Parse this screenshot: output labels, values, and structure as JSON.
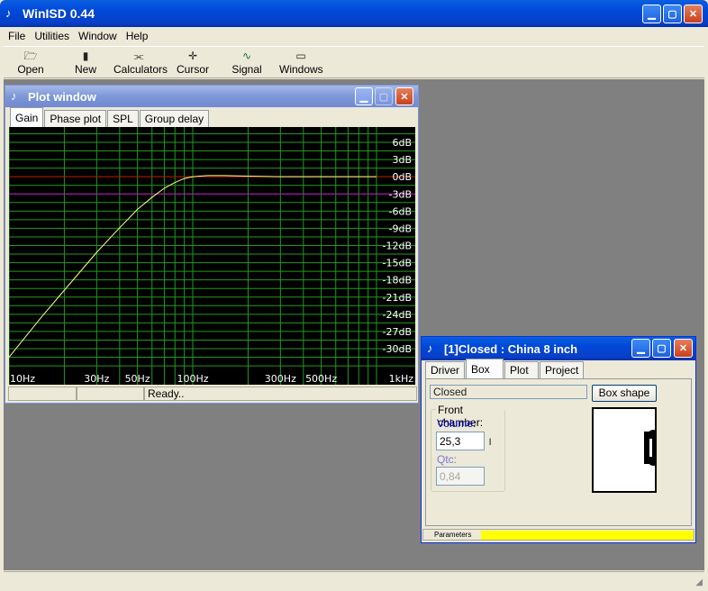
{
  "main_window": {
    "title": "WinISD 0.44",
    "menu": [
      "File",
      "Utilities",
      "Window",
      "Help"
    ],
    "toolbar": [
      {
        "label": "Open",
        "icon": "open-folder-icon"
      },
      {
        "label": "New",
        "icon": "new-document-icon"
      },
      {
        "label": "Calculators",
        "icon": "calculator-icon"
      },
      {
        "label": "Cursor",
        "icon": "cursor-crosshair-icon"
      },
      {
        "label": "Signal gen.",
        "icon": "sine-wave-icon"
      },
      {
        "label": "Windows",
        "icon": "window-icon"
      }
    ]
  },
  "plot_window": {
    "title": "Plot window",
    "tabs": [
      "Gain",
      "Phase plot",
      "SPL",
      "Group delay"
    ],
    "active_tab": "Gain",
    "status_text": "Ready.."
  },
  "chart_data": {
    "type": "line",
    "x_scale": "log",
    "xlim": [
      10,
      1000
    ],
    "ylim": [
      -33,
      9
    ],
    "x_tick_labels": [
      "10Hz",
      "30Hz",
      "50Hz",
      "100Hz",
      "300Hz",
      "500Hz",
      "1kHz"
    ],
    "x_ticks": [
      10,
      30,
      50,
      100,
      300,
      500,
      1000
    ],
    "y_tick_labels": [
      "6dB",
      "3dB",
      "0dB",
      "-3dB",
      "-6dB",
      "-9dB",
      "-12dB",
      "-15dB",
      "-18dB",
      "-21dB",
      "-24dB",
      "-27dB",
      "-30dB"
    ],
    "y_ticks": [
      6,
      3,
      0,
      -3,
      -6,
      -9,
      -12,
      -15,
      -18,
      -21,
      -24,
      -27,
      -30
    ],
    "reference_lines": {
      "red_db": 0,
      "magenta_db": -3
    },
    "series": [
      {
        "color": "#ffff80",
        "x": [
          10,
          15,
          20,
          30,
          40,
          50,
          60,
          70,
          80,
          90,
          100,
          120,
          150,
          200,
          300,
          500,
          1000
        ],
        "y": [
          -31.5,
          -24.5,
          -19.8,
          -13.2,
          -8.9,
          -5.7,
          -3.6,
          -2.0,
          -1.0,
          -0.3,
          0.0,
          0.2,
          0.2,
          0.1,
          0.0,
          0.0,
          0.0
        ]
      }
    ],
    "grid": true
  },
  "driver_window": {
    "title": "[1]Closed : China 8 inch",
    "tabs": [
      "Driver",
      "Box",
      "Plot",
      "Project"
    ],
    "active_tab": "Box",
    "box_type": "Closed",
    "box_shape_button": "Box shape",
    "front_chamber_label": "Front chamber:",
    "volume_label": "Volume:",
    "volume_value": "25,3",
    "volume_unit": "l",
    "qtc_label": "Qtc:",
    "qtc_value": "0,84",
    "parameters_label": "Parameters",
    "progress": 1.0
  }
}
